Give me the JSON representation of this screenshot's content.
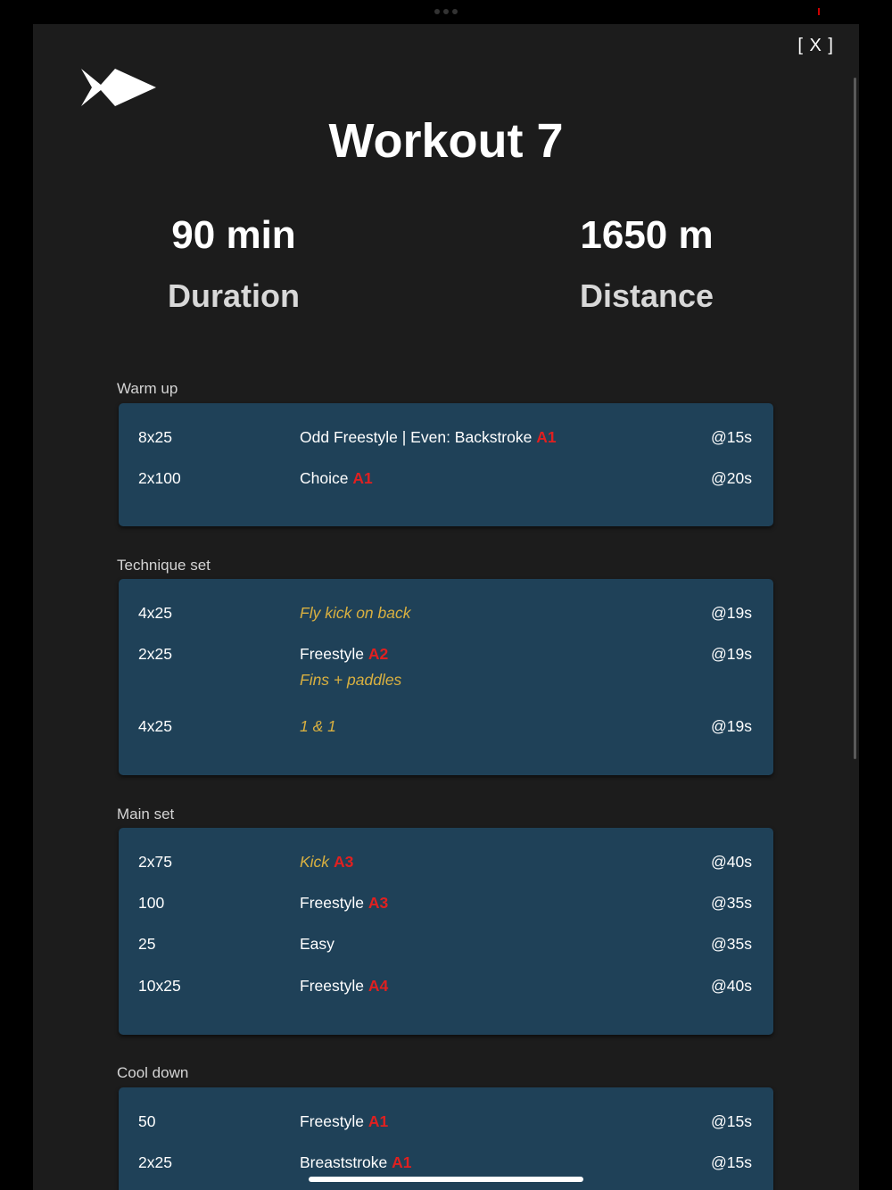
{
  "header": {
    "close_label": "[ X ]",
    "title": "Workout 7"
  },
  "stats": {
    "duration_value": "90 min",
    "duration_label": "Duration",
    "distance_value": "1650 m",
    "distance_label": "Distance"
  },
  "sections": {
    "warmup": {
      "label": "Warm up",
      "rows": [
        {
          "reps": "8x25",
          "desc": "Odd Freestyle | Even: Backstroke",
          "tag": "A1",
          "interval": "@15s"
        },
        {
          "reps": "2x100",
          "desc": "Choice",
          "tag": "A1",
          "interval": "@20s"
        }
      ]
    },
    "technique": {
      "label": "Technique set",
      "rows": [
        {
          "reps": "4x25",
          "desc": "Fly kick on back",
          "interval": "@19s"
        },
        {
          "reps": "2x25",
          "desc": "Freestyle",
          "tag": "A2",
          "note": "Fins + paddles",
          "interval": "@19s"
        },
        {
          "reps": "4x25",
          "desc": "1 & 1",
          "interval": "@19s"
        }
      ]
    },
    "main": {
      "label": "Main set",
      "rows": [
        {
          "reps": "2x75",
          "desc": "Kick",
          "tag": "A3",
          "interval": "@40s"
        },
        {
          "reps": "100",
          "desc": "Freestyle",
          "tag": "A3",
          "interval": "@35s"
        },
        {
          "reps": "25",
          "desc": "Easy",
          "interval": "@35s"
        },
        {
          "reps": "10x25",
          "desc": "Freestyle",
          "tag": "A4",
          "interval": "@40s"
        }
      ]
    },
    "cooldown": {
      "label": "Cool down",
      "rows": [
        {
          "reps": "50",
          "desc": "Freestyle",
          "tag": "A1",
          "interval": "@15s"
        },
        {
          "reps": "2x25",
          "desc": "Breaststroke",
          "tag": "A1",
          "interval": "@15s"
        }
      ]
    }
  },
  "colors": {
    "background": "#1c1c1c",
    "card": "#1f4158",
    "tag_red": "#e02020",
    "note_yellow": "#d9b040"
  }
}
